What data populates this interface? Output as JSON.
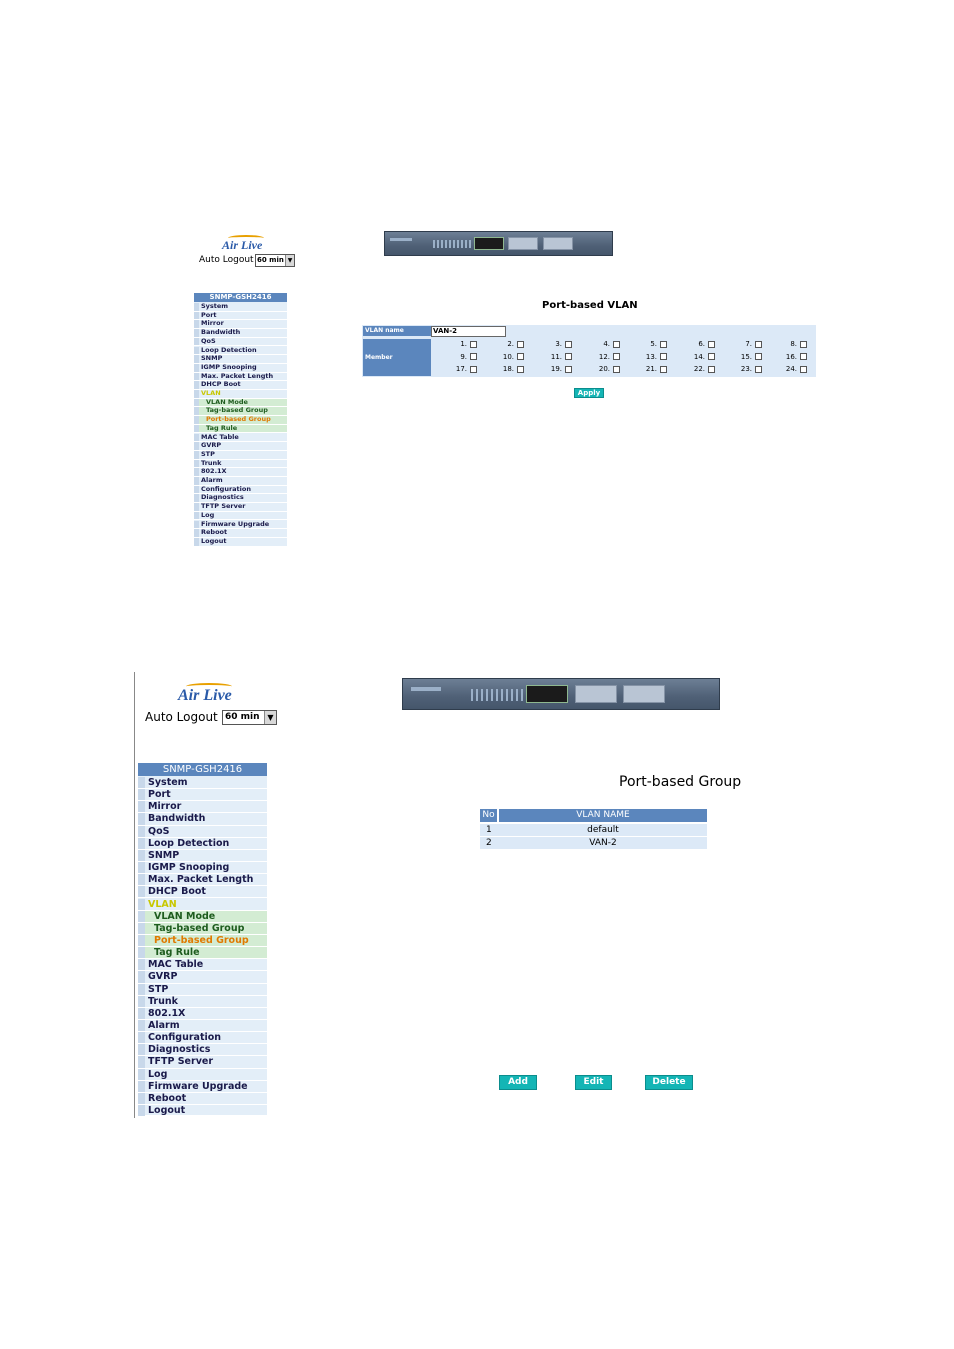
{
  "top": {
    "logo": "Air Live",
    "auto_logout_label": "Auto Logout",
    "auto_logout_value": "60 min",
    "menu_title": "SNMP-GSH2416",
    "page_title": "Port-based VLAN",
    "vlan_name_label": "VLAN name",
    "vlan_name_value": "VAN-2",
    "member_label": "Member",
    "ports": [
      "1.",
      "2.",
      "3.",
      "4.",
      "5.",
      "6.",
      "7.",
      "8.",
      "9.",
      "10.",
      "11.",
      "12.",
      "13.",
      "14.",
      "15.",
      "16.",
      "17.",
      "18.",
      "19.",
      "20.",
      "21.",
      "22.",
      "23.",
      "24."
    ],
    "apply_label": "Apply"
  },
  "bottom": {
    "logo": "Air Live",
    "auto_logout_label": "Auto Logout",
    "auto_logout_value": "60 min",
    "menu_title": "SNMP-GSH2416",
    "page_title": "Port-based Group",
    "table_headers": [
      "No",
      "VLAN NAME"
    ],
    "rows": [
      {
        "no": "1",
        "name": "default"
      },
      {
        "no": "2",
        "name": "VAN-2"
      }
    ],
    "buttons": {
      "add": "Add",
      "edit": "Edit",
      "delete": "Delete"
    }
  },
  "menu_items": [
    {
      "label": "System",
      "kind": "main"
    },
    {
      "label": "Port",
      "kind": "main"
    },
    {
      "label": "Mirror",
      "kind": "main"
    },
    {
      "label": "Bandwidth",
      "kind": "main"
    },
    {
      "label": "QoS",
      "kind": "main"
    },
    {
      "label": "Loop Detection",
      "kind": "main"
    },
    {
      "label": "SNMP",
      "kind": "main"
    },
    {
      "label": "IGMP Snooping",
      "kind": "main"
    },
    {
      "label": "Max. Packet Length",
      "kind": "main"
    },
    {
      "label": "DHCP Boot",
      "kind": "main"
    },
    {
      "label": "VLAN",
      "kind": "vlan"
    },
    {
      "label": "VLAN Mode",
      "kind": "sub"
    },
    {
      "label": "Tag-based Group",
      "kind": "sub"
    },
    {
      "label": "Port-based Group",
      "kind": "active"
    },
    {
      "label": "Tag Rule",
      "kind": "sub"
    },
    {
      "label": "MAC Table",
      "kind": "main"
    },
    {
      "label": "GVRP",
      "kind": "main"
    },
    {
      "label": "STP",
      "kind": "main"
    },
    {
      "label": "Trunk",
      "kind": "main"
    },
    {
      "label": "802.1X",
      "kind": "main"
    },
    {
      "label": "Alarm",
      "kind": "main"
    },
    {
      "label": "Configuration",
      "kind": "main"
    },
    {
      "label": "Diagnostics",
      "kind": "main"
    },
    {
      "label": "TFTP Server",
      "kind": "main"
    },
    {
      "label": "Log",
      "kind": "main"
    },
    {
      "label": "Firmware Upgrade",
      "kind": "main"
    },
    {
      "label": "Reboot",
      "kind": "main"
    },
    {
      "label": "Logout",
      "kind": "main"
    }
  ],
  "colors": {
    "menu_header": "#5b86bd",
    "menu_bg": "#e3eef8",
    "submenu_bg": "#d3ecd3",
    "active_item": "#e07a00",
    "button": "#14b5b5"
  }
}
